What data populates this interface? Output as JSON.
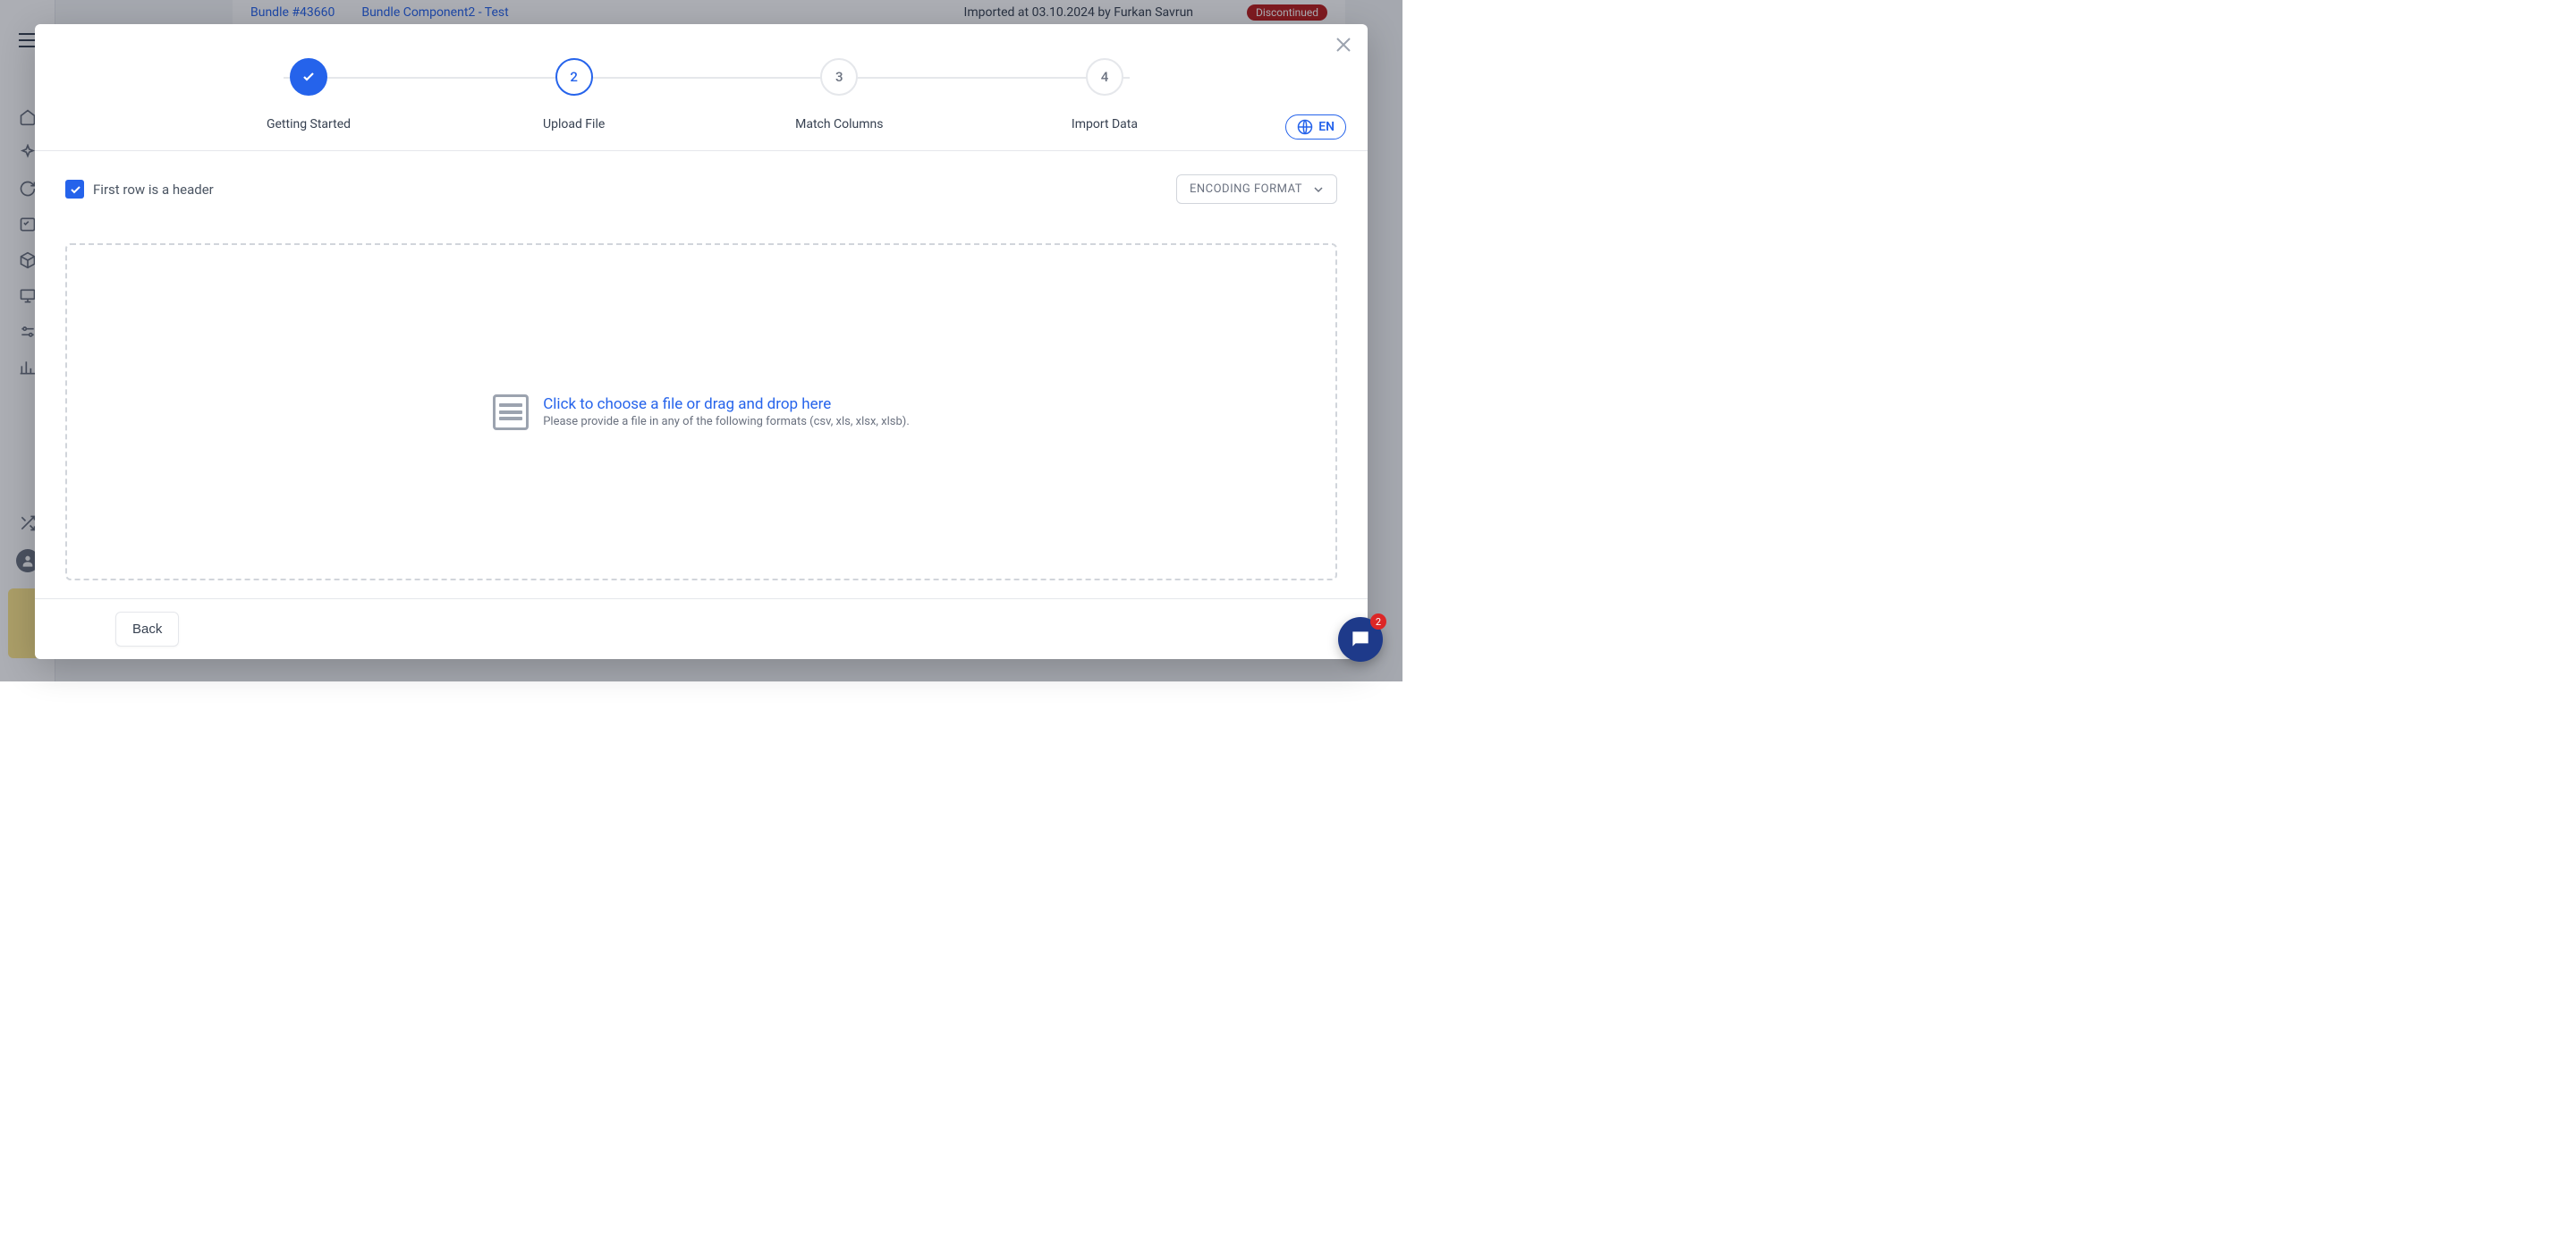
{
  "background": {
    "bundle_link": "Bundle #43660",
    "component_link": "Bundle Component2 - Test",
    "imported_text": "Imported at 03.10.2024 by Furkan Savrun",
    "status_badge": "Discontinued"
  },
  "stepper": {
    "steps": [
      {
        "label": "Getting Started"
      },
      {
        "label": "Upload File",
        "num": "2"
      },
      {
        "label": "Match Columns",
        "num": "3"
      },
      {
        "label": "Import Data",
        "num": "4"
      }
    ]
  },
  "lang": {
    "code": "EN"
  },
  "body": {
    "checkbox_label": "First row is a header",
    "encoding_label": "ENCODING FORMAT",
    "dropzone_title": "Click to choose a file or drag and drop here",
    "dropzone_sub": "Please provide a file in any of the following formats (csv, xls, xlsx, xlsb)."
  },
  "footer": {
    "back": "Back"
  },
  "chat": {
    "badge": "2"
  }
}
